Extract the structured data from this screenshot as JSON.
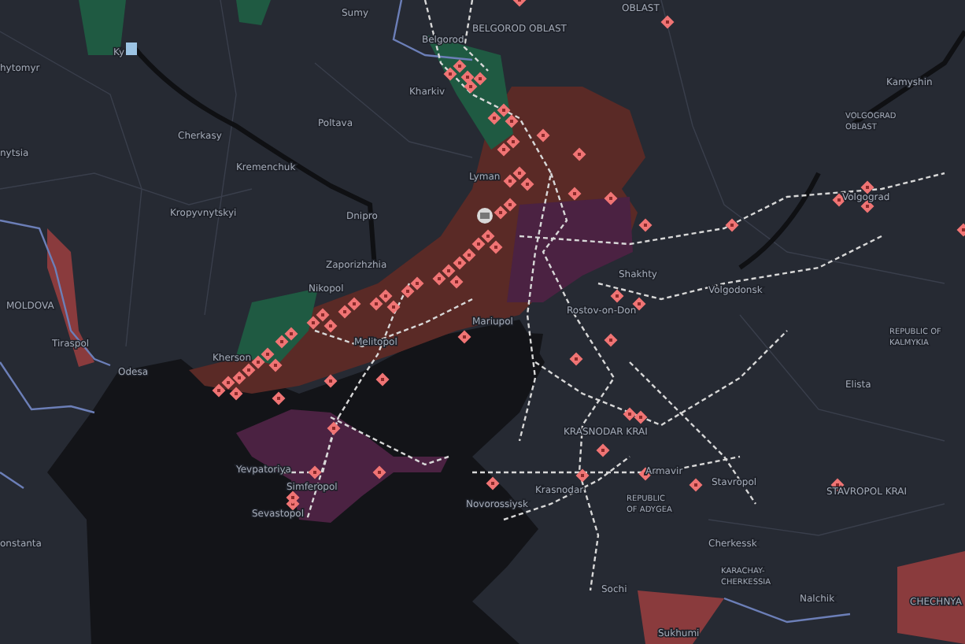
{
  "map": {
    "areas": [
      {
        "kind": "occupied",
        "color": "#5a2a26"
      },
      {
        "kind": "crimea",
        "color": "#4b2242"
      },
      {
        "kind": "donetsk",
        "color": "#4b2242"
      },
      {
        "kind": "liberated",
        "color": "#1f5a42"
      },
      {
        "kind": "separatist",
        "color": "#8a3b3d"
      }
    ],
    "labels": [
      {
        "lines": [
          "hytomyr"
        ]
      },
      {
        "lines": [
          "Ky"
        ]
      },
      {
        "lines": [
          "Sumy"
        ]
      },
      {
        "lines": [
          "BELGOROD OBLAST"
        ]
      },
      {
        "lines": [
          "Belgorod"
        ]
      },
      {
        "lines": [
          "Kharkiv"
        ]
      },
      {
        "lines": [
          "Poltava"
        ]
      },
      {
        "lines": [
          "Cherkasy"
        ]
      },
      {
        "lines": [
          "Kremenchuk"
        ]
      },
      {
        "lines": [
          "Lyman"
        ]
      },
      {
        "lines": [
          "Kropyvnytskyi"
        ]
      },
      {
        "lines": [
          "Dnipro"
        ]
      },
      {
        "lines": [
          "Zaporizhzhia"
        ]
      },
      {
        "lines": [
          "Nikopol"
        ]
      },
      {
        "lines": [
          "nytsia"
        ]
      },
      {
        "lines": [
          "MOLDOVA"
        ]
      },
      {
        "lines": [
          "Tiraspol"
        ]
      },
      {
        "lines": [
          "Odesa"
        ]
      },
      {
        "lines": [
          "Kherson"
        ]
      },
      {
        "lines": [
          "Melitopol"
        ]
      },
      {
        "lines": [
          "Mariupol"
        ]
      },
      {
        "lines": [
          "OBLAST"
        ]
      },
      {
        "lines": [
          "Kamyshin"
        ]
      },
      {
        "lines": [
          "VOLGOGRAD",
          "OBLAST"
        ]
      },
      {
        "lines": [
          "Volgograd"
        ]
      },
      {
        "lines": [
          "Shakhty"
        ]
      },
      {
        "lines": [
          "Volgodonsk"
        ]
      },
      {
        "lines": [
          "Rostov-on-Don"
        ]
      },
      {
        "lines": [
          "REPUBLIC OF",
          "KALMYKIA"
        ]
      },
      {
        "lines": [
          "Elista"
        ]
      },
      {
        "lines": [
          "KRASNODAR KRAI"
        ]
      },
      {
        "lines": [
          "Krasnodar"
        ]
      },
      {
        "lines": [
          "Novorossiysk"
        ]
      },
      {
        "lines": [
          "Armavir"
        ]
      },
      {
        "lines": [
          "Stavropol"
        ]
      },
      {
        "lines": [
          "STAVROPOL KRAI"
        ]
      },
      {
        "lines": [
          "REPUBLIC",
          "OF ADYGEA"
        ]
      },
      {
        "lines": [
          "Cherkessk"
        ]
      },
      {
        "lines": [
          "KARACHAY-",
          "CHERKESSIA"
        ]
      },
      {
        "lines": [
          "Nalchik"
        ]
      },
      {
        "lines": [
          "CHECHNYA"
        ]
      },
      {
        "lines": [
          "Sochi"
        ]
      },
      {
        "lines": [
          "Sukhumi"
        ]
      },
      {
        "lines": [
          "Yevpatoriya"
        ]
      },
      {
        "lines": [
          "Simferopol"
        ]
      },
      {
        "lines": [
          "Sevastopol"
        ]
      },
      {
        "lines": [
          "onstanta"
        ]
      }
    ]
  }
}
